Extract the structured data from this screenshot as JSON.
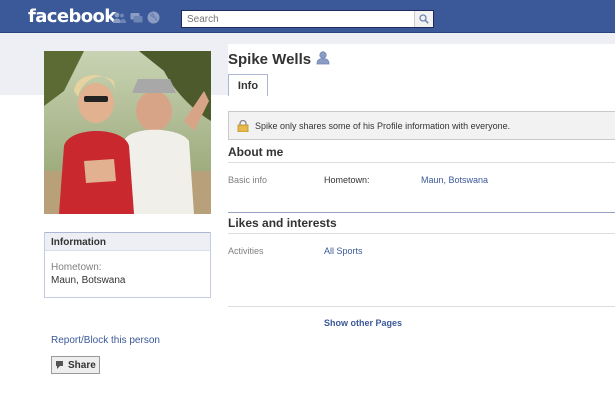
{
  "header": {
    "logo_text": "facebook",
    "search_placeholder": "Search",
    "brand_color": "#3b5998"
  },
  "profile": {
    "name": "Spike Wells",
    "tabs": [
      {
        "label": "Info",
        "active": true
      }
    ],
    "notice": "Spike only shares some of his Profile information with everyone."
  },
  "sidebar": {
    "information_header": "Information",
    "hometown_label": "Hometown:",
    "hometown_value": "Maun, Botswana",
    "report_link": "Report/Block this person",
    "share_label": "Share"
  },
  "about": {
    "title": "About me",
    "basic_info_label": "Basic info",
    "hometown_key": "Hometown:",
    "hometown_value": "Maun, Botswana"
  },
  "likes": {
    "title": "Likes and interests",
    "activities_label": "Activities",
    "activities_value": "All Sports"
  },
  "footer": {
    "show_other_pages": "Show other Pages"
  }
}
